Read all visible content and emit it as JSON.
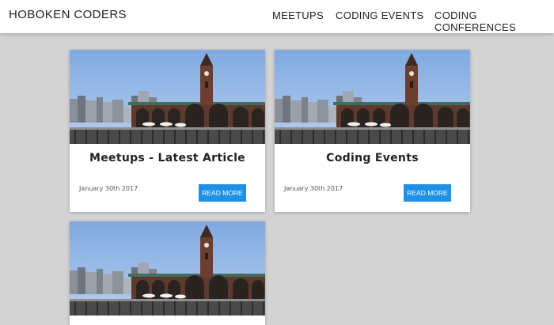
{
  "header": {
    "brand": "HOBOKEN CODERS",
    "nav": [
      "MEETUPS",
      "CODING EVENTS",
      "CODING CONFERENCES"
    ]
  },
  "cards": [
    {
      "title": "Meetups - Latest Article",
      "date": "January 30th 2017",
      "button": "READ MORE"
    },
    {
      "title": "Coding Events",
      "date": "January 30th 2017",
      "button": "READ MORE"
    },
    {
      "title": "",
      "date": "",
      "button": ""
    }
  ],
  "colors": {
    "accent": "#1e90e6",
    "background": "#d3d3d3"
  }
}
